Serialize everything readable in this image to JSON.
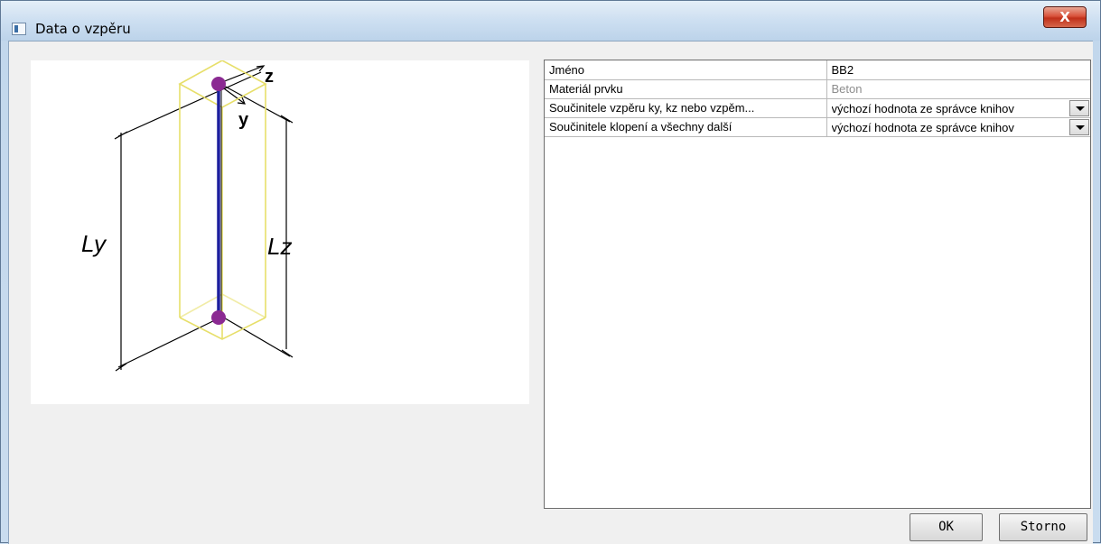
{
  "window": {
    "title": "Data o vzpěru",
    "close_label": "X"
  },
  "diagram": {
    "label_z": "z",
    "label_y": "y",
    "label_ly": "Ly",
    "label_lz": "Lz",
    "colors": {
      "box": "#e7df6a",
      "member": "#1d1f9e",
      "nodes": "#8b2a92",
      "dimension": "#000000"
    }
  },
  "properties": {
    "rows": [
      {
        "name": "Jméno",
        "value": "BB2",
        "type": "text"
      },
      {
        "name": "Materiál prvku",
        "value": "Beton",
        "type": "readonly"
      },
      {
        "name": "Součinitele vzpěru ky, kz nebo vzpěm...",
        "value": "výchozí hodnota ze správce knihov",
        "type": "dropdown"
      },
      {
        "name": "Součinitele klopení a všechny další",
        "value": "výchozí hodnota ze správce knihov",
        "type": "dropdown"
      }
    ]
  },
  "buttons": {
    "ok": "OK",
    "cancel": "Storno"
  }
}
